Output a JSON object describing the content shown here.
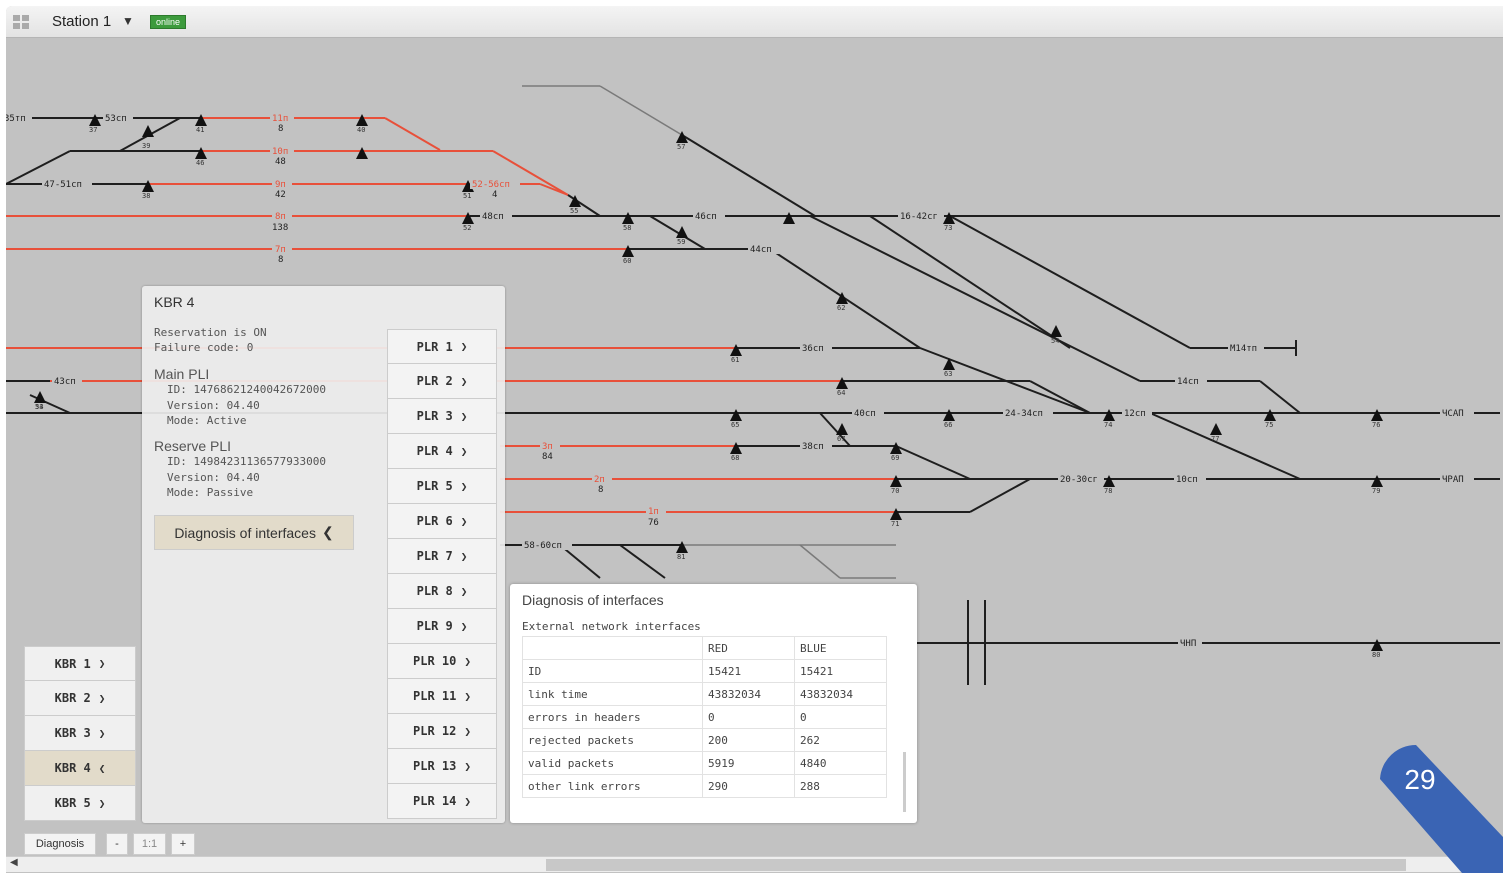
{
  "header": {
    "station": "Station 1",
    "status": "online"
  },
  "schema": {
    "labels": [
      "35тп",
      "53сп",
      "11п",
      "8",
      "10п",
      "48",
      "47-51сп",
      "9п",
      "42",
      "52-56сп",
      "4",
      "8п",
      "138",
      "48сп",
      "7п",
      "8",
      "46сп",
      "44сп",
      "16-42сг",
      "43сп",
      "36сп",
      "40сп",
      "24-34сп",
      "12сп",
      "14сп",
      "М14тп",
      "ЧСАП",
      "3п",
      "84",
      "38сп",
      "2п",
      "8",
      "20-30сг",
      "10сп",
      "ЧРАП",
      "1п",
      "76",
      "58-60сп",
      "ЧНП"
    ],
    "nodes": [
      "37",
      "41",
      "39",
      "40",
      "46",
      "38",
      "51",
      "52",
      "55",
      "58",
      "59",
      "60",
      "57",
      "73",
      "62",
      "61",
      "64",
      "63",
      "54",
      "65",
      "66",
      "67",
      "68",
      "69",
      "70",
      "71",
      "74",
      "75",
      "76",
      "77",
      "78",
      "79",
      "80",
      "81",
      "53",
      "34"
    ]
  },
  "kbr_panel": {
    "title": "KBR 4",
    "reservation": "Reservation is ON",
    "failure": "Failure code: 0",
    "main_pli": {
      "title": "Main PLI",
      "id": "ID: 14768621240042672000",
      "version": "Version: 04.40",
      "mode": "Mode: Active"
    },
    "reserve_pli": {
      "title": "Reserve PLI",
      "id": "ID: 14984231136577933000",
      "version": "Version: 04.40",
      "mode": "Mode: Passive"
    },
    "diag_button": "Diagnosis of interfaces",
    "plr": [
      "PLR 1",
      "PLR 2",
      "PLR 3",
      "PLR 4",
      "PLR 5",
      "PLR 6",
      "PLR 7",
      "PLR 8",
      "PLR 9",
      "PLR 10",
      "PLR 11",
      "PLR 12",
      "PLR 13",
      "PLR 14"
    ]
  },
  "kbr_list": [
    "KBR 1",
    "KBR 2",
    "KBR 3",
    "KBR 4",
    "KBR 5"
  ],
  "kbr_active": "KBR 4",
  "diagnosis": {
    "title": "Diagnosis of interfaces",
    "subtitle": "External network interfaces",
    "columns": [
      "",
      "RED",
      "BLUE"
    ],
    "rows": [
      [
        "ID",
        "15421",
        "15421"
      ],
      [
        "link time",
        "43832034",
        "43832034"
      ],
      [
        "errors in headers",
        "0",
        "0"
      ],
      [
        "rejected packets",
        "200",
        "262"
      ],
      [
        "valid packets",
        "5919",
        "4840"
      ],
      [
        "other link errors",
        "290",
        "288"
      ]
    ]
  },
  "bottom": {
    "diagnosis": "Diagnosis",
    "minus": "-",
    "zoom": "1:1",
    "plus": "+"
  },
  "slide": {
    "number": "29"
  },
  "colors": {
    "track_red": "#e8503a",
    "track_black": "#1e1e1e",
    "badge_green": "#3d9b3d",
    "slide_blue": "#3a64b4",
    "active_tab": "#e2dbca"
  }
}
